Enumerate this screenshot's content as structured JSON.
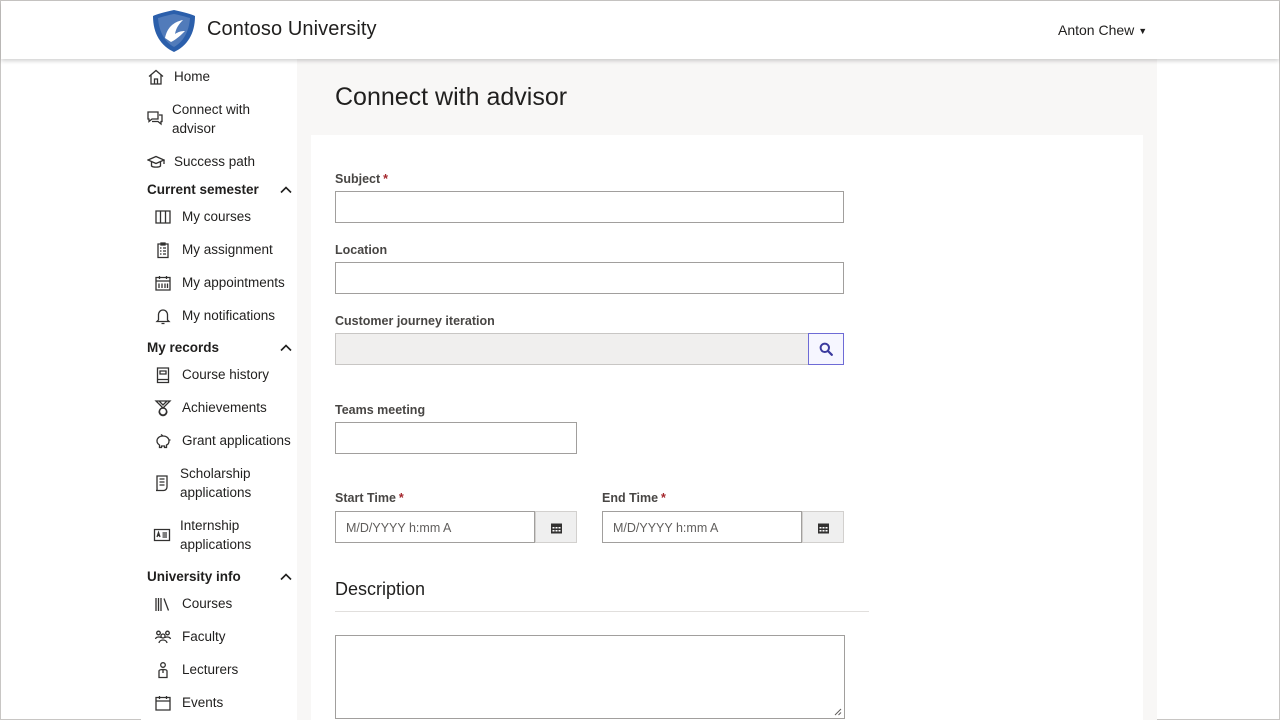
{
  "header": {
    "brand": "Contoso University",
    "user_name": "Anton Chew",
    "logo_color": "#2b5fab"
  },
  "sidebar": {
    "top_items": [
      {
        "label": "Home",
        "icon": "home-icon"
      },
      {
        "label": "Connect with advisor",
        "icon": "chat-icon"
      },
      {
        "label": "Success path",
        "icon": "graduation-cap-icon"
      }
    ],
    "sections": [
      {
        "title": "Current semester",
        "items": [
          {
            "label": "My courses",
            "icon": "book-icon"
          },
          {
            "label": "My assignment",
            "icon": "clipboard-icon"
          },
          {
            "label": "My appointments",
            "icon": "calendar-icon"
          },
          {
            "label": "My notifications",
            "icon": "bell-icon"
          }
        ]
      },
      {
        "title": "My records",
        "items": [
          {
            "label": "Course history",
            "icon": "notebook-icon"
          },
          {
            "label": "Achievements",
            "icon": "medal-icon"
          },
          {
            "label": "Grant applications",
            "icon": "piggy-bank-icon"
          },
          {
            "label": "Scholarship applications",
            "icon": "certificate-icon"
          },
          {
            "label": "Internship applications",
            "icon": "id-card-icon"
          }
        ]
      },
      {
        "title": "University info",
        "items": [
          {
            "label": "Courses",
            "icon": "library-icon"
          },
          {
            "label": "Faculty",
            "icon": "people-icon"
          },
          {
            "label": "Lecturers",
            "icon": "person-icon"
          },
          {
            "label": "Events",
            "icon": "calendar-icon"
          }
        ]
      }
    ]
  },
  "main": {
    "title": "Connect with advisor",
    "form": {
      "subject_label": "Subject",
      "location_label": "Location",
      "journey_label": "Customer journey iteration",
      "teams_label": "Teams meeting",
      "start_label": "Start Time",
      "end_label": "End Time",
      "date_placeholder": "M/D/YYYY h:mm A",
      "required_mark": "*",
      "description_title": "Description"
    }
  },
  "colors": {
    "accent": "#5b57d1",
    "required": "#a4262c"
  }
}
